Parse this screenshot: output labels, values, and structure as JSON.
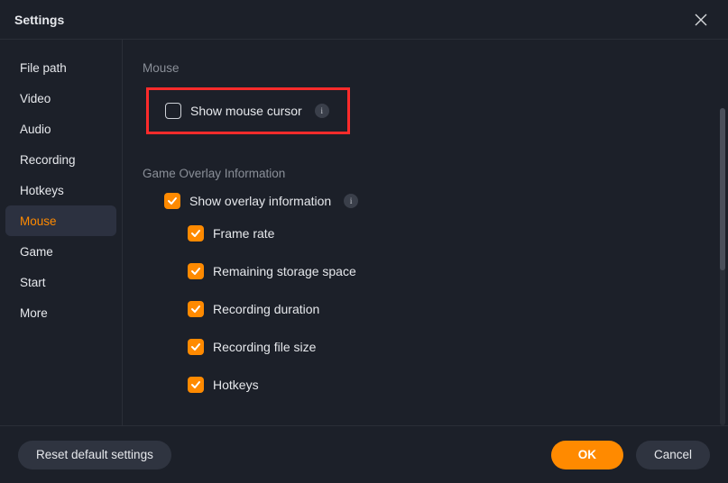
{
  "window": {
    "title": "Settings"
  },
  "sidebar": {
    "items": [
      {
        "label": "File path",
        "name": "sidebar-item-file-path"
      },
      {
        "label": "Video",
        "name": "sidebar-item-video"
      },
      {
        "label": "Audio",
        "name": "sidebar-item-audio"
      },
      {
        "label": "Recording",
        "name": "sidebar-item-recording"
      },
      {
        "label": "Hotkeys",
        "name": "sidebar-item-hotkeys"
      },
      {
        "label": "Mouse",
        "name": "sidebar-item-mouse",
        "active": true
      },
      {
        "label": "Game",
        "name": "sidebar-item-game"
      },
      {
        "label": "Start",
        "name": "sidebar-item-start"
      },
      {
        "label": "More",
        "name": "sidebar-item-more"
      }
    ]
  },
  "sections": {
    "mouse": {
      "title": "Mouse",
      "options": {
        "show_cursor": {
          "label": "Show mouse cursor",
          "checked": false,
          "info": true
        }
      }
    },
    "overlay": {
      "title": "Game Overlay Information",
      "show_overlay": {
        "label": "Show overlay information",
        "checked": true,
        "info": true
      },
      "subs": [
        {
          "label": "Frame rate",
          "checked": true
        },
        {
          "label": "Remaining storage space",
          "checked": true
        },
        {
          "label": "Recording duration",
          "checked": true
        },
        {
          "label": "Recording file size",
          "checked": true
        },
        {
          "label": "Hotkeys",
          "checked": true
        }
      ]
    }
  },
  "footer": {
    "reset": "Reset default settings",
    "ok": "OK",
    "cancel": "Cancel"
  },
  "icons": {
    "info_glyph": "i"
  }
}
